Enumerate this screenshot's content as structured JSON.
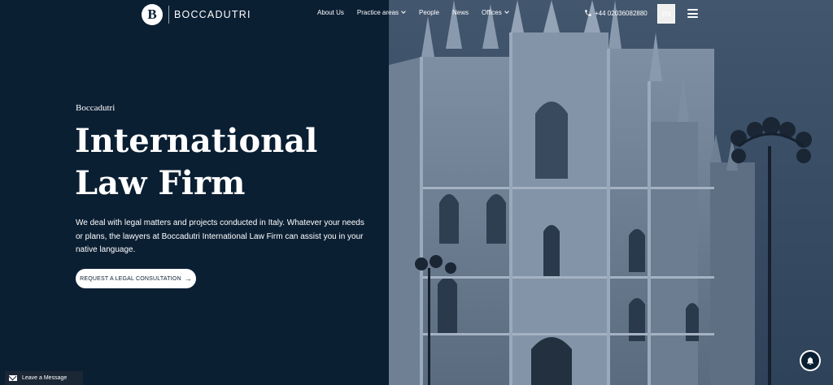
{
  "brand": {
    "mark": "B",
    "name": "BOCCADUTRI"
  },
  "nav": {
    "items": [
      {
        "label": "About Us",
        "dropdown": false
      },
      {
        "label": "Practice areas",
        "dropdown": true
      },
      {
        "label": "People",
        "dropdown": false
      },
      {
        "label": "News",
        "dropdown": false
      },
      {
        "label": "Offices",
        "dropdown": true
      }
    ]
  },
  "contact": {
    "phone": "+44 02036082880"
  },
  "language": {
    "current": "EN"
  },
  "hero": {
    "eyebrow": "Boccadutri",
    "title_line1": "International",
    "title_line2": "Law Firm",
    "description": "We deal with legal matters and projects conducted in Italy. Whatever your needs or plans, the lawyers at Boccadutri International Law Firm can assist you in your native language.",
    "cta_label": "REQUEST A LEGAL CONSULTATION",
    "cta_arrow": "→"
  },
  "widgets": {
    "chat_label": "Leave a Message"
  },
  "colors": {
    "navy": "#0b1f33",
    "white": "#ffffff",
    "overlay": "#3f5269"
  }
}
